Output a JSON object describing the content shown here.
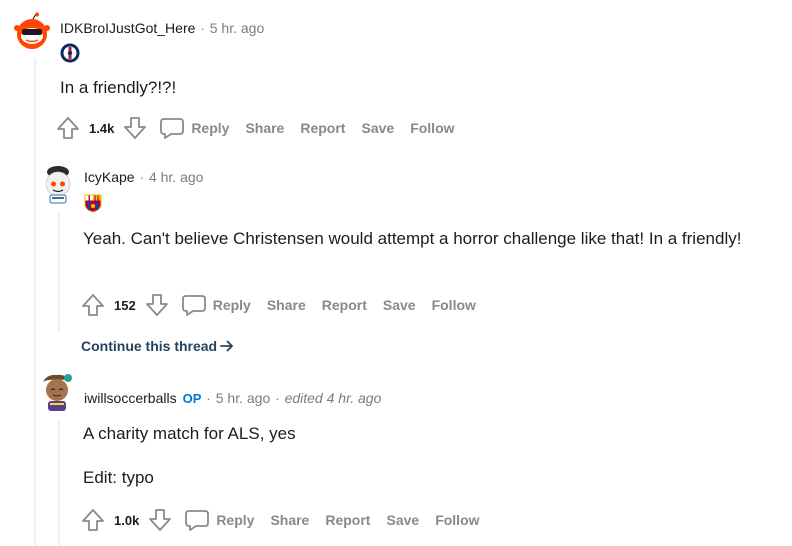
{
  "comments": [
    {
      "username": "IDKBroIJustGot_Here",
      "time": "5 hr. ago",
      "flair_icon": "psg-crest-icon",
      "body": "In a friendly?!?!",
      "score": "1.4k"
    },
    {
      "username": "IcyKape",
      "time": "4 hr. ago",
      "flair_icon": "barcelona-crest-icon",
      "body": "Yeah. Can't believe Christensen would attempt a horror challenge like that! In a friendly!",
      "score": "152"
    },
    {
      "username": "iwillsoccerballs",
      "op_badge": "OP",
      "time": "5 hr. ago",
      "edited": "edited 4 hr. ago",
      "body_lines": [
        "A charity match for ALS, yes",
        "Edit: typo"
      ],
      "score": "1.0k"
    }
  ],
  "actions": {
    "reply": "Reply",
    "share": "Share",
    "report": "Report",
    "save": "Save",
    "follow": "Follow"
  },
  "continue_thread": "Continue this thread",
  "separator": "·",
  "colors": {
    "text": "#1c1c1c",
    "meta": "#7c7c7c",
    "action": "#878a8c",
    "op": "#0079d3",
    "continue": "#24435f",
    "thread_line": "#edeff1"
  }
}
